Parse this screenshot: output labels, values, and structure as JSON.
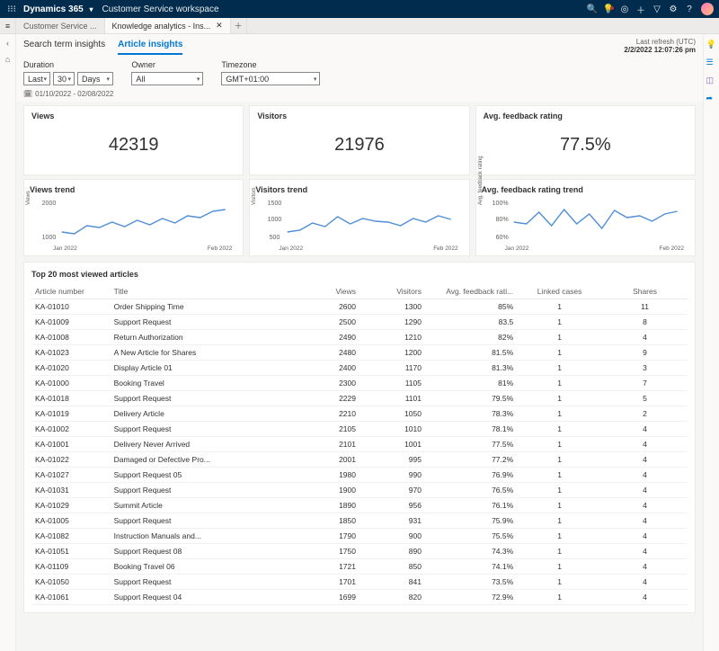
{
  "topbar": {
    "brand": "Dynamics 365",
    "workspace": "Customer Service workspace"
  },
  "tabs": {
    "t0": "Customer Service ...",
    "t1": "Knowledge analytics - Ins..."
  },
  "subtabs": {
    "search": "Search term insights",
    "article": "Article insights"
  },
  "refresh": {
    "label": "Last refresh (UTC)",
    "time": "2/2/2022 12:07:26 pm"
  },
  "filters": {
    "duration_label": "Duration",
    "duration_mode": "Last",
    "duration_n": "30",
    "duration_unit": "Days",
    "daterange": "01/10/2022 - 02/08/2022",
    "owner_label": "Owner",
    "owner_val": "All",
    "tz_label": "Timezone",
    "tz_val": "GMT+01:00"
  },
  "kpi": {
    "views_label": "Views",
    "views_val": "42319",
    "visitors_label": "Visitors",
    "visitors_val": "21976",
    "afr_label": "Avg. feedback rating",
    "afr_val": "77.5%"
  },
  "trends": {
    "views_label": "Views trend",
    "visitors_label": "Visitors trend",
    "afr_label": "Avg. feedback rating trend",
    "x_start": "Jan 2022",
    "x_end": "Feb 2022",
    "y_views": "Views",
    "y_visitors": "Visitors",
    "y_afr": "Avg. feedback rating"
  },
  "chart_data": [
    {
      "type": "line",
      "title": "Views trend",
      "xlabel": "",
      "ylabel": "Views",
      "ylim": [
        1000,
        2000
      ],
      "x": [
        "Jan 2022",
        "",
        "",
        "",
        "",
        "",
        "",
        "",
        "",
        "",
        "",
        "",
        "",
        "Feb 2022"
      ],
      "values": [
        1250,
        1200,
        1420,
        1380,
        1520,
        1400,
        1580,
        1460,
        1620,
        1500,
        1700,
        1650,
        1800,
        1850
      ]
    },
    {
      "type": "line",
      "title": "Visitors trend",
      "xlabel": "",
      "ylabel": "Visitors",
      "ylim": [
        500,
        1500
      ],
      "x": [
        "Jan 2022",
        "",
        "",
        "",
        "",
        "",
        "",
        "",
        "",
        "",
        "",
        "",
        "",
        "Feb 2022"
      ],
      "values": [
        700,
        750,
        900,
        820,
        1020,
        880,
        1000,
        940,
        920,
        850,
        1000,
        920,
        1050,
        980
      ]
    },
    {
      "type": "line",
      "title": "Avg. feedback rating trend",
      "xlabel": "",
      "ylabel": "Avg. feedback rating",
      "ylim": [
        60,
        100
      ],
      "x": [
        "Jan 2022",
        "",
        "",
        "",
        "",
        "",
        "",
        "",
        "",
        "",
        "",
        "",
        "",
        "Feb 2022"
      ],
      "values": [
        78,
        76,
        85,
        74,
        88,
        76,
        84,
        72,
        86,
        80,
        82,
        78,
        84,
        86
      ]
    }
  ],
  "table": {
    "title": "Top 20 most viewed articles",
    "cols": [
      "Article number",
      "Title",
      "Views",
      "Visitors",
      "Avg. feedback rati...",
      "Linked cases",
      "Shares"
    ],
    "rows": [
      [
        "KA-01010",
        "Order Shipping Time",
        "2600",
        "1300",
        "85%",
        "1",
        "11"
      ],
      [
        "KA-01009",
        "Support Request",
        "2500",
        "1290",
        "83.5",
        "1",
        "8"
      ],
      [
        "KA-01008",
        "Return Authorization",
        "2490",
        "1210",
        "82%",
        "1",
        "4"
      ],
      [
        "KA-01023",
        "A New Article for Shares",
        "2480",
        "1200",
        "81.5%",
        "1",
        "9"
      ],
      [
        "KA-01020",
        "Display Article 01",
        "2400",
        "1170",
        "81.3%",
        "1",
        "3"
      ],
      [
        "KA-01000",
        "Booking Travel",
        "2300",
        "1105",
        "81%",
        "1",
        "7"
      ],
      [
        "KA-01018",
        "Support Request",
        "2229",
        "1101",
        "79.5%",
        "1",
        "5"
      ],
      [
        "KA-01019",
        "Delivery Article",
        "2210",
        "1050",
        "78.3%",
        "1",
        "2"
      ],
      [
        "KA-01002",
        "Support Request",
        "2105",
        "1010",
        "78.1%",
        "1",
        "4"
      ],
      [
        "KA-01001",
        "Delivery Never Arrived",
        "2101",
        "1001",
        "77.5%",
        "1",
        "4"
      ],
      [
        "KA-01022",
        "Damaged or Defective Pro...",
        "2001",
        "995",
        "77.2%",
        "1",
        "4"
      ],
      [
        "KA-01027",
        "Support Request 05",
        "1980",
        "990",
        "76.9%",
        "1",
        "4"
      ],
      [
        "KA-01031",
        "Support Request",
        "1900",
        "970",
        "76.5%",
        "1",
        "4"
      ],
      [
        "KA-01029",
        "Summit Article",
        "1890",
        "956",
        "76.1%",
        "1",
        "4"
      ],
      [
        "KA-01005",
        "Support Request",
        "1850",
        "931",
        "75.9%",
        "1",
        "4"
      ],
      [
        "KA-01082",
        "Instruction Manuals and...",
        "1790",
        "900",
        "75.5%",
        "1",
        "4"
      ],
      [
        "KA-01051",
        "Support Request 08",
        "1750",
        "890",
        "74.3%",
        "1",
        "4"
      ],
      [
        "KA-01109",
        "Booking Travel 06",
        "1721",
        "850",
        "74.1%",
        "1",
        "4"
      ],
      [
        "KA-01050",
        "Support Request",
        "1701",
        "841",
        "73.5%",
        "1",
        "4"
      ],
      [
        "KA-01061",
        "Support Request 04",
        "1699",
        "820",
        "72.9%",
        "1",
        "4"
      ]
    ]
  }
}
